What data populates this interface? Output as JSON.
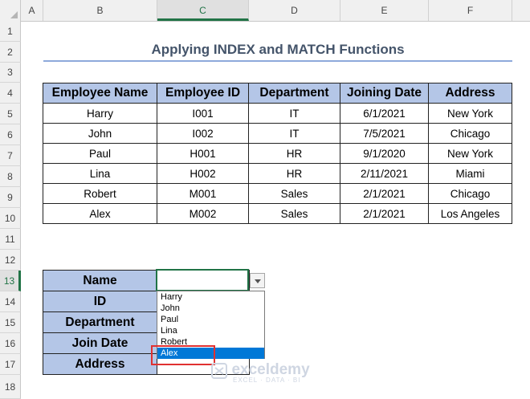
{
  "columns": [
    "A",
    "B",
    "C",
    "D",
    "E",
    "F"
  ],
  "rows": [
    "1",
    "2",
    "3",
    "4",
    "5",
    "6",
    "7",
    "8",
    "9",
    "10",
    "11",
    "12",
    "13",
    "14",
    "15",
    "16",
    "17",
    "18"
  ],
  "title": "Applying INDEX and MATCH Functions",
  "table": {
    "headers": [
      "Employee Name",
      "Employee ID",
      "Department",
      "Joining Date",
      "Address"
    ],
    "rows": [
      [
        "Harry",
        "I001",
        "IT",
        "6/1/2021",
        "New York"
      ],
      [
        "John",
        "I002",
        "IT",
        "7/5/2021",
        "Chicago"
      ],
      [
        "Paul",
        "H001",
        "HR",
        "9/1/2020",
        "New York"
      ],
      [
        "Lina",
        "H002",
        "HR",
        "2/11/2021",
        "Miami"
      ],
      [
        "Robert",
        "M001",
        "Sales",
        "2/1/2021",
        "Chicago"
      ],
      [
        "Alex",
        "M002",
        "Sales",
        "2/1/2021",
        "Los Angeles"
      ]
    ]
  },
  "lookup": {
    "labels": [
      "Name",
      "ID",
      "Department",
      "Join Date",
      "Address"
    ]
  },
  "dropdown": {
    "options": [
      "Harry",
      "John",
      "Paul",
      "Lina",
      "Robert",
      "Alex"
    ],
    "selected": "Alex"
  },
  "watermark": {
    "name": "exceldemy",
    "tagline": "EXCEL · DATA · BI"
  },
  "colors": {
    "header_fill": "#b4c6e7",
    "accent_green": "#217346",
    "highlight": "#0078d7",
    "callout_red": "#e03131"
  }
}
